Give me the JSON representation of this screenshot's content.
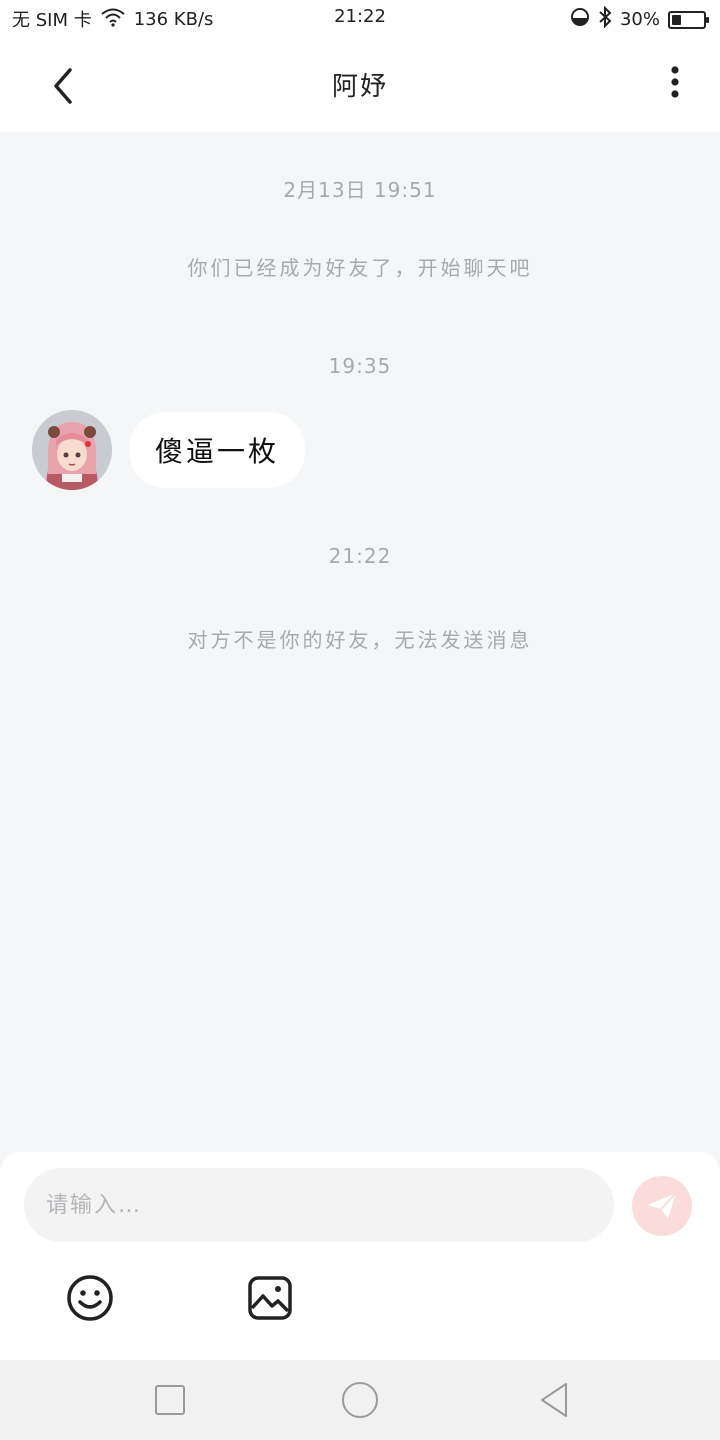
{
  "status_bar": {
    "sim": "无 SIM 卡",
    "speed": "136 KB/s",
    "time": "21:22",
    "battery_text": "30%",
    "battery_level": 0.3
  },
  "header": {
    "title": "阿妤",
    "back_icon": "chevron-left-icon",
    "more_icon": "more-vertical-icon"
  },
  "chat": {
    "timestamp_1": "2月13日 19:51",
    "system_msg_1": "你们已经成为好友了，开始聊天吧",
    "timestamp_2": "19:35",
    "message_text": "傻逼一枚",
    "timestamp_3": "21:22",
    "system_msg_2": "对方不是你的好友，无法发送消息"
  },
  "composer": {
    "placeholder": "请输入…",
    "send_icon": "send-icon",
    "emoji_icon": "emoji-icon",
    "image_icon": "image-icon",
    "accent": "#f6a3a1"
  },
  "navbar": {
    "recent_icon": "square-icon",
    "home_icon": "circle-icon",
    "back_icon": "triangle-back-icon"
  }
}
